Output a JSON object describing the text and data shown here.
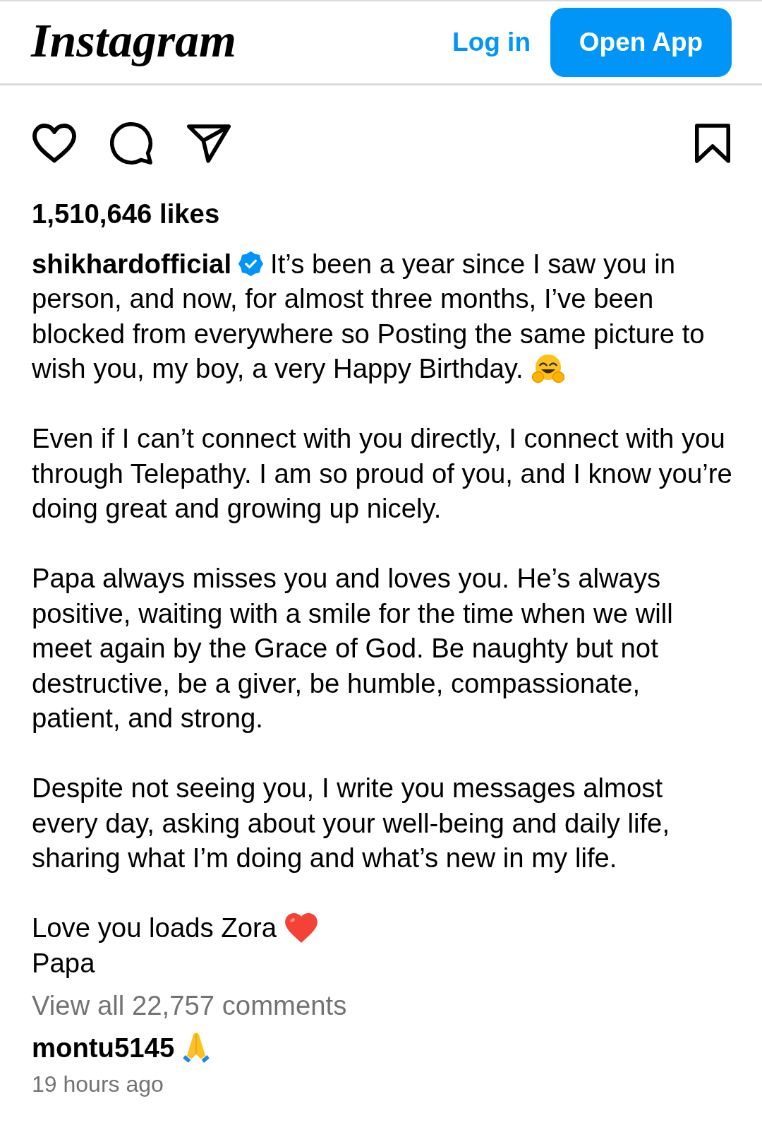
{
  "header": {
    "logo": "Instagram",
    "login_link": "Log in",
    "open_app_button": "Open App"
  },
  "post": {
    "liked": false,
    "saved": false,
    "likes": "1,510,646 likes",
    "caption": {
      "username": "shikhardofficial",
      "verified": true,
      "paragraphs": [
        [
          "It’s been a year since I saw you in person, and now, for almost three months, I’ve been blocked from everywhere so Posting the same picture to wish you, my boy, a very Happy Birthday."
        ],
        [
          "Even if I can’t connect with you directly, I connect with you through Telepathy. I am so proud of you, and I know you’re doing great and growing up nicely."
        ],
        [
          "Papa always misses you and loves you. He’s always positive, waiting with a smile for the time when we will meet again by the Grace of God. Be naughty but not destructive, be a giver, be humble, compassionate, patient, and strong."
        ],
        [
          "Despite not seeing you, I write you messages almost every day, asking about your well-being and daily life, sharing what I’m doing and what’s new in my life."
        ],
        [
          "Love you loads Zora",
          "Papa"
        ]
      ]
    },
    "comments_link": "View all 22,757 comments",
    "top_comment": {
      "username": "montu5145",
      "time": "19 hours ago"
    }
  }
}
